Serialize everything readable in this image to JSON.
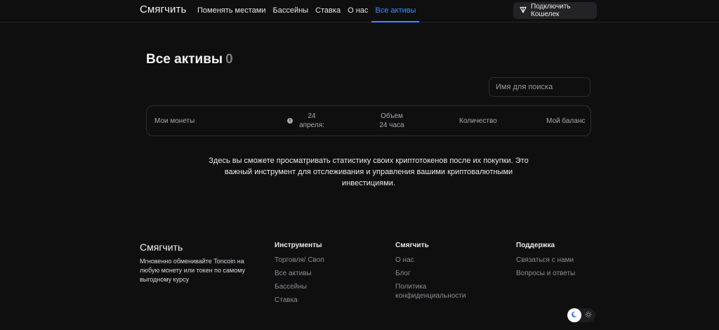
{
  "header": {
    "logo": "Смягчить",
    "nav": [
      {
        "label": "Поменять местами"
      },
      {
        "label": "Бассейны"
      },
      {
        "label": "Ставка"
      },
      {
        "label": "О нас"
      },
      {
        "label": "Все активы",
        "active": true
      }
    ],
    "wallet_button": "Подключить Кошелек",
    "wallet_icon": "ton-icon"
  },
  "main": {
    "title": "Все активы",
    "count": "0",
    "search_placeholder": "Имя для поиска",
    "table_columns": {
      "coins": "Мои монеты",
      "date": "24 апреля:",
      "volume": "Объем 24 часа",
      "quantity": "Количество",
      "balance": "Мой баланс"
    },
    "empty_message": "Здесь вы сможете просматривать статистику своих криптотокенов после их покупки. Это важный инструмент для отслеживания и управления вашими криптовалютными инвестициями."
  },
  "footer": {
    "logo": "Смягчить",
    "description": "Мгновенно обменивайте Toncoin на любую монету или токен по самому выгодному курсу",
    "columns": [
      {
        "title": "Инструменты",
        "links": [
          "Торговля/ Своп",
          "Все активы",
          "Бассейны",
          "Ставка"
        ]
      },
      {
        "title": "Смягчить",
        "links": [
          "О нас",
          "Блог",
          "Политика конфиденциальности"
        ]
      },
      {
        "title": "Поддержка",
        "links": [
          "Связаться с нами",
          "Вопросы и ответы"
        ]
      }
    ]
  },
  "colors": {
    "background": "#0f0f10",
    "accent": "#3d8bff",
    "border": "#2e2e33"
  }
}
